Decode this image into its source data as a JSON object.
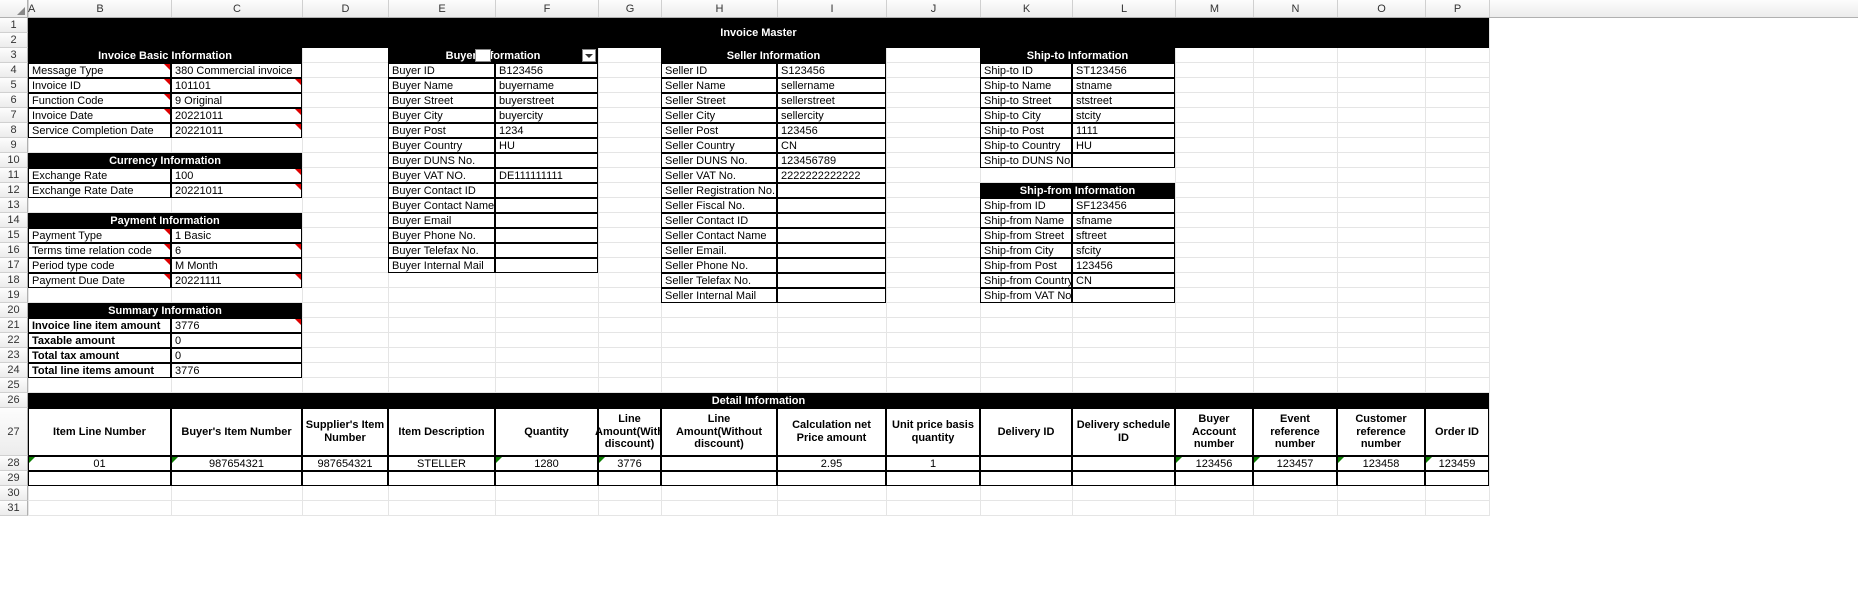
{
  "columns": [
    "A",
    "B",
    "C",
    "D",
    "E",
    "F",
    "G",
    "H",
    "I",
    "J",
    "K",
    "L",
    "M",
    "N",
    "O",
    "P"
  ],
  "rowCount": 31,
  "rowHeight27": 48,
  "title": "Invoice Master",
  "sections": {
    "basic": {
      "title": "Invoice Basic Information",
      "rows": [
        {
          "label": "Message Type",
          "value": "380 Commercial invoice",
          "redL": true
        },
        {
          "label": "Invoice ID",
          "value": "101101",
          "redL": true,
          "redV": true
        },
        {
          "label": "Function Code",
          "value": "9 Original",
          "redL": true
        },
        {
          "label": "Invoice Date",
          "value": "20221011",
          "redL": true,
          "redV": true
        },
        {
          "label": "Service Completion Date",
          "value": "20221011",
          "redV": true
        }
      ]
    },
    "currency": {
      "title": "Currency Information",
      "rows": [
        {
          "label": "Exchange Rate",
          "value": "100",
          "redV": true
        },
        {
          "label": "Exchange Rate Date",
          "value": "20221011",
          "redV": true
        }
      ]
    },
    "payment": {
      "title": "Payment Information",
      "rows": [
        {
          "label": "Payment Type",
          "value": "1 Basic",
          "redL": true
        },
        {
          "label": "Terms time relation code",
          "value": "6",
          "redL": true,
          "redV": true
        },
        {
          "label": "Period type code",
          "value": "M Month",
          "redL": true
        },
        {
          "label": "Payment Due Date",
          "value": "20221111",
          "redL": true,
          "redV": true
        }
      ]
    },
    "summary": {
      "title": "Summary Information",
      "rows": [
        {
          "label": "Invoice line item amount",
          "value": "3776",
          "redV": true
        },
        {
          "label": "Taxable amount",
          "value": "0"
        },
        {
          "label": "Total tax amount",
          "value": "0"
        },
        {
          "label": "Total line items amount",
          "value": "3776"
        }
      ]
    },
    "buyer": {
      "title": "Buyer Information",
      "rows": [
        {
          "label": "Buyer ID",
          "value": "B123456"
        },
        {
          "label": "Buyer Name",
          "value": "buyername"
        },
        {
          "label": "Buyer Street",
          "value": "buyerstreet"
        },
        {
          "label": "Buyer City",
          "value": "buyercity"
        },
        {
          "label": "Buyer Post",
          "value": "1234"
        },
        {
          "label": "Buyer Country",
          "value": "HU"
        },
        {
          "label": "Buyer DUNS No.",
          "value": ""
        },
        {
          "label": "Buyer VAT NO.",
          "value": "DE111111111"
        },
        {
          "label": "Buyer Contact ID",
          "value": ""
        },
        {
          "label": "Buyer Contact Name",
          "value": ""
        },
        {
          "label": "Buyer Email",
          "value": ""
        },
        {
          "label": "Buyer Phone No.",
          "value": ""
        },
        {
          "label": "Buyer Telefax No.",
          "value": ""
        },
        {
          "label": "Buyer Internal Mail",
          "value": ""
        }
      ]
    },
    "seller": {
      "title": "Seller Information",
      "rows": [
        {
          "label": "Seller ID",
          "value": "S123456"
        },
        {
          "label": "Seller Name",
          "value": "sellername"
        },
        {
          "label": "Seller Street",
          "value": "sellerstreet"
        },
        {
          "label": "Seller City",
          "value": "sellercity"
        },
        {
          "label": "Seller Post",
          "value": "123456"
        },
        {
          "label": "Seller Country",
          "value": "CN"
        },
        {
          "label": "Seller DUNS No.",
          "value": "123456789"
        },
        {
          "label": "Seller VAT No.",
          "value": "2222222222222"
        },
        {
          "label": "Seller Registration No.",
          "value": ""
        },
        {
          "label": "Seller Fiscal No.",
          "value": ""
        },
        {
          "label": "Seller Contact ID",
          "value": ""
        },
        {
          "label": "Seller Contact Name",
          "value": ""
        },
        {
          "label": "Seller Email.",
          "value": ""
        },
        {
          "label": "Seller Phone No.",
          "value": ""
        },
        {
          "label": "Seller Telefax No.",
          "value": ""
        },
        {
          "label": "Seller Internal Mail",
          "value": ""
        }
      ]
    },
    "shipto": {
      "title": "Ship-to Information",
      "rows": [
        {
          "label": "Ship-to ID",
          "value": "ST123456"
        },
        {
          "label": "Ship-to Name",
          "value": "stname"
        },
        {
          "label": "Ship-to Street",
          "value": "ststreet"
        },
        {
          "label": "Ship-to City",
          "value": "stcity"
        },
        {
          "label": "Ship-to Post",
          "value": "1111"
        },
        {
          "label": "Ship-to Country",
          "value": "HU"
        },
        {
          "label": "Ship-to DUNS No.",
          "value": ""
        }
      ]
    },
    "shipfrom": {
      "title": "Ship-from Information",
      "rows": [
        {
          "label": "Ship-from ID",
          "value": "SF123456"
        },
        {
          "label": "Ship-from Name",
          "value": "sfname"
        },
        {
          "label": "Ship-from Street",
          "value": "sftreet"
        },
        {
          "label": "Ship-from City",
          "value": "sfcity"
        },
        {
          "label": "Ship-from Post",
          "value": "123456"
        },
        {
          "label": "Ship-from Country",
          "value": "CN"
        },
        {
          "label": "Ship-from VAT No.",
          "value": ""
        }
      ]
    }
  },
  "detail": {
    "title": "Detail Information",
    "headers": [
      "Item Line Number",
      "Buyer's Item Number",
      "Supplier's Item Number",
      "Item Description",
      "Quantity",
      "Line Amount(With discount)",
      "Line Amount(Without discount)",
      "Calculation net Price amount",
      "Unit price basis quantity",
      "Delivery ID",
      "Delivery schedule ID",
      "Buyer Account number",
      "Event reference number",
      "Customer reference number",
      "Order ID"
    ],
    "row": [
      "01",
      "987654321",
      "987654321",
      "STELLER",
      "1280",
      "3776",
      "",
      "2.95",
      "1",
      "",
      "",
      "123456",
      "123457",
      "123458",
      "123459"
    ],
    "greenTriCols": [
      0,
      1,
      4,
      5,
      11,
      12,
      13,
      14
    ]
  }
}
